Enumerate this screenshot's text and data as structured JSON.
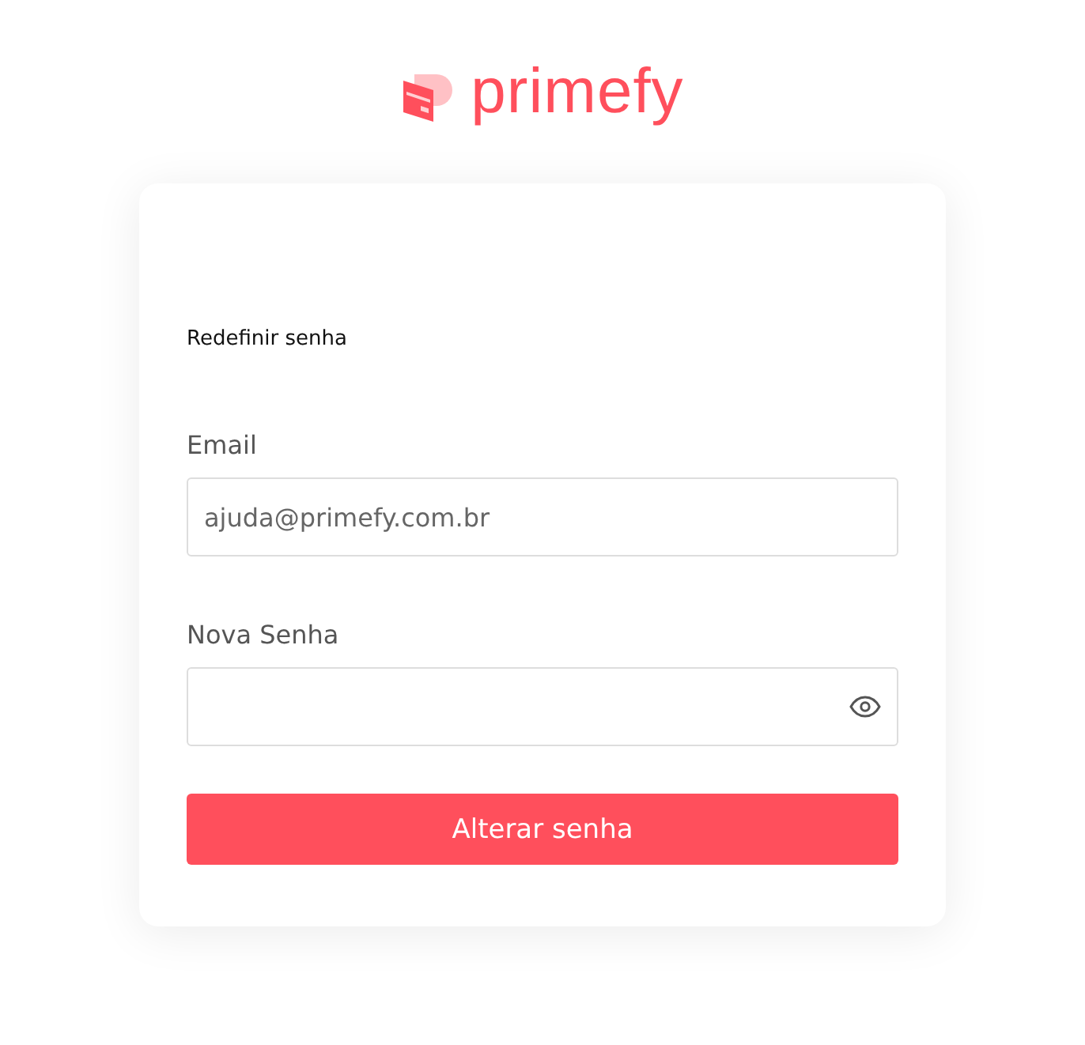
{
  "logo": {
    "text": "primefy"
  },
  "card": {
    "title": "Redefinir senha",
    "fields": [
      {
        "kind": "text",
        "label": "Email",
        "value": "ajuda@primefy.com.br"
      },
      {
        "kind": "password",
        "label": "Nova Senha"
      }
    ],
    "submit": "Alterar senha"
  }
}
